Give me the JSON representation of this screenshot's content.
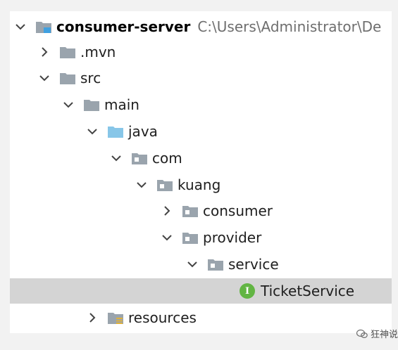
{
  "project": {
    "name": "consumer-server",
    "path": "C:\\Users\\Administrator\\De"
  },
  "tree": {
    "mvn": ".mvn",
    "src": "src",
    "main": "main",
    "java": "java",
    "com": "com",
    "kuang": "kuang",
    "consumer": "consumer",
    "provider": "provider",
    "service": "service",
    "ticket_service": "TicketService",
    "resources": "resources"
  },
  "interface_badge": "I",
  "watermark": {
    "text": "狂神说"
  },
  "colors": {
    "folder": "#9aa4ad",
    "source_folder": "#87c6e8",
    "module_accent": "#40a0e0",
    "interface_badge": "#62b543",
    "selected_row": "#d4d4d4",
    "resources_lines": "#e0b23a"
  }
}
